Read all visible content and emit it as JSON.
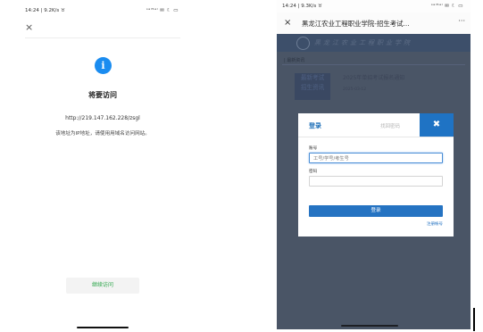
{
  "left": {
    "status": {
      "time_speed": "14:24 | 9.2K/s ♉",
      "icons": "ᵌᵃˡ⁵ᵃˡ ✉ ☾ ▭"
    },
    "close_glyph": "×",
    "icon_glyph": "i",
    "title": "将要访问",
    "url": "http://219.147.162.228/zsgl",
    "description": "该地址为IP地址，请使用用域名访问网站。",
    "continue_label": "继续访问"
  },
  "right": {
    "status": {
      "time_speed": "14:24 | 9.3K/s ♉",
      "icons": "ᵌᵃˡ⁵ᵃˡ ✉ ☾ ▭"
    },
    "close_glyph": "×",
    "page_title": "黑龙江农业工程职业学院-招生考试...",
    "more_glyph": "···",
    "banner_name": "黑龙江农业工程职业学院",
    "news": {
      "section_title": "| 最新资讯",
      "thumb_text": [
        "最新考试",
        "招生资讯"
      ],
      "item_title": "2025年单招考试报名通知",
      "item_meta": "2025-03-12"
    },
    "login": {
      "tab_login": "登录",
      "tab_forgot": "找回密码",
      "close_glyph": "✖",
      "account_label": "账号",
      "account_placeholder": "工号/学号/考生号",
      "password_label": "密码",
      "password_placeholder": "",
      "submit_label": "登录",
      "register_link": "注册帐号"
    }
  },
  "colors": {
    "accent_blue": "#1f73c4",
    "info_blue": "#1a8cf0",
    "continue_green": "#2aa548"
  }
}
